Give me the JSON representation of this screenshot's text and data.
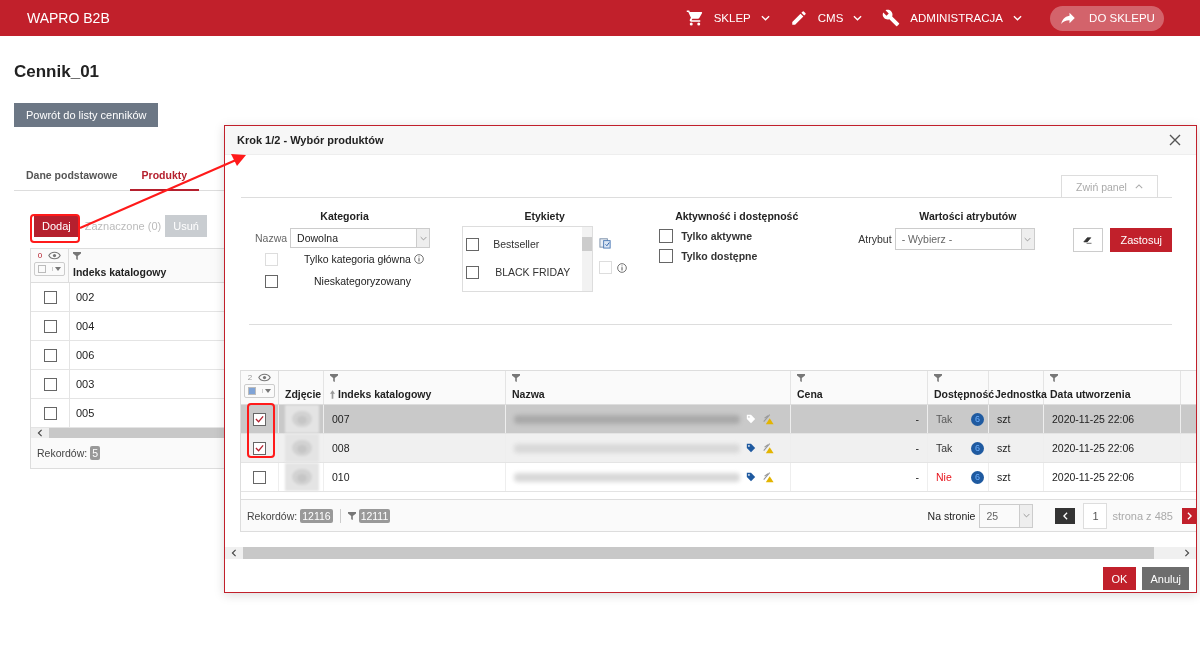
{
  "header": {
    "brand": "WAPRO B2B",
    "menu": [
      {
        "label": "SKLEP"
      },
      {
        "label": "CMS"
      },
      {
        "label": "ADMINISTRACJA"
      }
    ],
    "shop_button": "DO SKLEPU"
  },
  "page": {
    "title": "Cennik_01",
    "back_button": "Powrót do listy cenników",
    "tabs": [
      {
        "label": "Dane podstawowe",
        "selected": false
      },
      {
        "label": "Produkty",
        "selected": true
      }
    ]
  },
  "products": {
    "add_button": "Dodaj",
    "selected_label": "Zaznaczone (0)",
    "remove_button": "Usuń",
    "selected_count": "0",
    "column": "Indeks katalogowy",
    "rows": [
      {
        "index": "002",
        "checked": false
      },
      {
        "index": "004",
        "checked": false
      },
      {
        "index": "006",
        "checked": false
      },
      {
        "index": "003",
        "checked": false
      },
      {
        "index": "005",
        "checked": false
      }
    ],
    "records_label": "Rekordów:",
    "records": "5"
  },
  "dialog": {
    "title": "Krok 1/2 - Wybór produktów",
    "collapse_button": "Zwiń panel",
    "category": {
      "heading": "Kategoria",
      "name_label": "Nazwa",
      "name_value": "Dowolna",
      "options": [
        {
          "label": "Tylko kategoria główna",
          "checked": false,
          "disabled": true,
          "info": true
        },
        {
          "label": "Nieskategoryzowany",
          "checked": false,
          "disabled": false,
          "info": false
        }
      ]
    },
    "labels": {
      "heading": "Etykiety",
      "items": [
        {
          "label": "Bestseller",
          "checked": false
        },
        {
          "label": "BLACK FRIDAY",
          "checked": false
        }
      ],
      "toggle": {
        "checked": false,
        "disabled": true
      }
    },
    "activity": {
      "heading": "Aktywność i dostępność",
      "options": [
        {
          "label": "Tylko aktywne",
          "checked": false
        },
        {
          "label": "Tylko dostępne",
          "checked": false
        }
      ]
    },
    "attributes": {
      "heading": "Wartości atrybutów",
      "label": "Atrybut",
      "value": "- Wybierz -"
    },
    "apply_button": "Zastosuj",
    "grid": {
      "selected_count": "2",
      "columns": [
        {
          "label": "Zdjęcie",
          "filter": false,
          "sorted": false
        },
        {
          "label": "Indeks katalogowy",
          "filter": true,
          "sorted": true
        },
        {
          "label": "Nazwa",
          "filter": true,
          "sorted": false
        },
        {
          "label": "Cena",
          "filter": true,
          "sorted": false
        },
        {
          "label": "Dostępność",
          "filter": true,
          "sorted": false
        },
        {
          "label": "Jednostka",
          "filter": false,
          "sorted": false
        },
        {
          "label": "Data utworzenia",
          "filter": true,
          "sorted": false
        }
      ],
      "rows": [
        {
          "checked": true,
          "highlighted": true,
          "index": "007",
          "price": "-",
          "availability": "Tak",
          "available": true,
          "badge": "6",
          "unit": "szt",
          "created": "2020-11-25 22:06"
        },
        {
          "checked": true,
          "highlighted": false,
          "index": "008",
          "price": "-",
          "availability": "Tak",
          "available": true,
          "badge": "6",
          "unit": "szt",
          "created": "2020-11-25 22:06"
        },
        {
          "checked": false,
          "highlighted": false,
          "index": "010",
          "price": "-",
          "availability": "Nie",
          "available": false,
          "badge": "6",
          "unit": "szt",
          "created": "2020-11-25 22:06"
        }
      ],
      "records_label": "Rekordów:",
      "records": "12116",
      "filtered": "12111",
      "page_size_label": "Na stronie",
      "page_size": "25",
      "page": "1",
      "page_total": "strona z 485"
    },
    "ok_button": "OK",
    "cancel_button": "Anuluj"
  }
}
